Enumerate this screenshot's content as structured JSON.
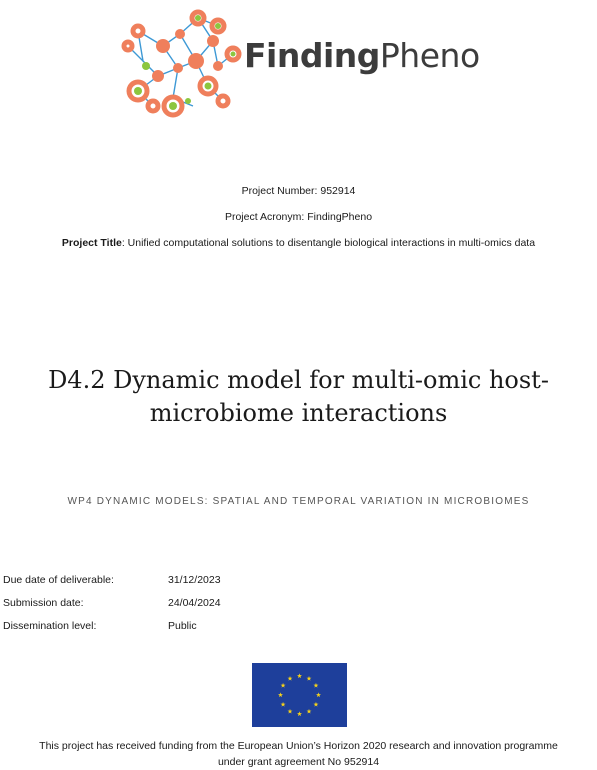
{
  "logo": {
    "brand_bold": "Finding",
    "brand_light": "Pheno",
    "colors": {
      "orange": "#ef7f5c",
      "green": "#8cc63f",
      "blue": "#2a8fd1",
      "text": "#3c3c3c"
    }
  },
  "project": {
    "number_label": "Project Number:",
    "number_value": "952914",
    "acronym_label": "Project Acronym:",
    "acronym_value": "FindingPheno",
    "title_label": "Project Title",
    "title_value": ": Unified computational solutions to disentangle biological interactions in multi-omics data"
  },
  "deliverable": {
    "title_line1": "D4.2 Dynamic model for multi-omic host-",
    "title_line2": "microbiome interactions",
    "work_package": "WP4 DYNAMIC MODELS: SPATIAL AND TEMPORAL VARIATION IN MICROBIOMES"
  },
  "meta": [
    {
      "label": "Due date of deliverable:",
      "value": "31/12/2023"
    },
    {
      "label": "Submission date:",
      "value": "24/04/2024"
    },
    {
      "label": "Dissemination level:",
      "value": "Public"
    }
  ],
  "eu_flag": {
    "colors": {
      "blue": "#1e3f9b",
      "star": "#f6d21a"
    }
  },
  "footer": {
    "line1": "This project has received funding from the European Union’s Horizon 2020 research and innovation programme",
    "line2": "under grant agreement No 952914"
  }
}
